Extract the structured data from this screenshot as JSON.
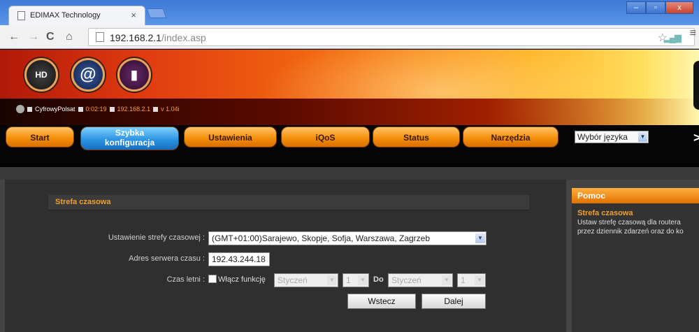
{
  "browser": {
    "tab_title": "EDIMAX Technology",
    "tab_close": "×",
    "url_host": "192.168.2.1",
    "url_path": "/index.asp",
    "win_minimize": "–",
    "win_maximize": "▫",
    "win_close": "x"
  },
  "router": {
    "icons": [
      "HD",
      "@",
      "▮"
    ],
    "status": {
      "operator": "CyfrowyPolsat",
      "uptime": "0:02:19",
      "ip": "192.168.2.1",
      "version": "v 1.04i"
    },
    "menu": [
      {
        "label": "Start"
      },
      {
        "label": "Szybka konfiguracja",
        "line1": "Szybka",
        "line2": "konfiguracja",
        "active": true
      },
      {
        "label": "Ustawienia"
      },
      {
        "label": "iQoS"
      },
      {
        "label": "Status"
      },
      {
        "label": "Narzędzia"
      }
    ],
    "language_select": "Wybór języka"
  },
  "section": {
    "title": "Strefa czasowa",
    "timezone_label": "Ustawienie strefy czasowej :",
    "timezone_value": "(GMT+01:00)Sarajewo, Skopje, Sofja, Warszawa, Zagrzeb",
    "server_label": "Adres serwera czasu :",
    "server_value": "192.43.244.18",
    "dst_label": "Czas letni :",
    "dst_enable_label": "Włącz funkcję",
    "dst_from_month": "Styczeń",
    "dst_from_day": "1",
    "dst_to_label": "Do",
    "dst_to_month": "Styczeń",
    "dst_to_day": "1",
    "back_button": "Wstecz",
    "next_button": "Dalej"
  },
  "help": {
    "header": "Pomoc",
    "title": "Strefa czasowa",
    "text_line1": "Ustaw strefę czasową dla routera",
    "text_line2": "przez dziennik zdarzeń oraz do ko"
  },
  "colors": {
    "accent_orange": "#f5900a",
    "active_blue": "#2790e0",
    "section_title": "#f0a030"
  }
}
